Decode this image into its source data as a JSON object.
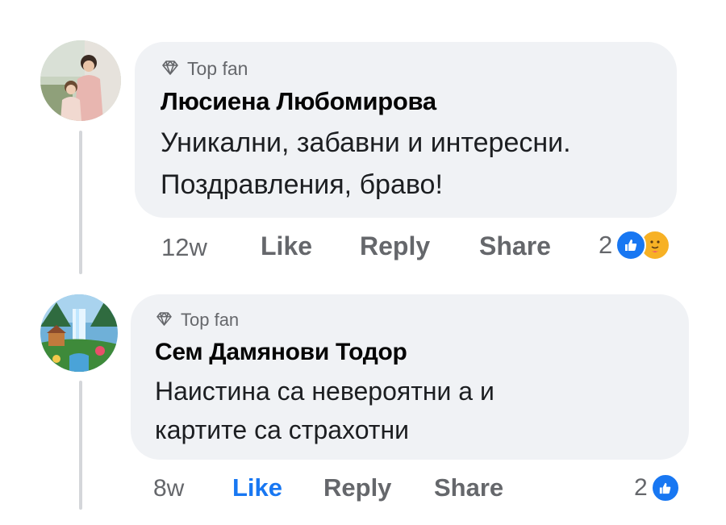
{
  "comments": [
    {
      "badge": "Top fan",
      "author": "Люсиена Любомирова",
      "text_lines": [
        "Уникални, забавни и интересни.",
        "Поздравления, браво!"
      ],
      "time": "12w",
      "like_label": "Like",
      "like_active": false,
      "reply_label": "Reply",
      "share_label": "Share",
      "reaction_count": "2",
      "reaction_icons": [
        "like-icon",
        "care-icon"
      ]
    },
    {
      "badge": "Top fan",
      "author": "Сем Дамянови Тодор",
      "text_lines": [
        "Наистина са невероятни а и",
        "картите са страхотни"
      ],
      "time": "8w",
      "like_label": "Like",
      "like_active": true,
      "reply_label": "Reply",
      "share_label": "Share",
      "reaction_count": "2",
      "reaction_icons": [
        "like-icon"
      ]
    }
  ],
  "colors": {
    "bubble": "#f0f2f5",
    "meta": "#65676b",
    "like_blue": "#1877f2",
    "thread_line": "#d4d6da"
  }
}
